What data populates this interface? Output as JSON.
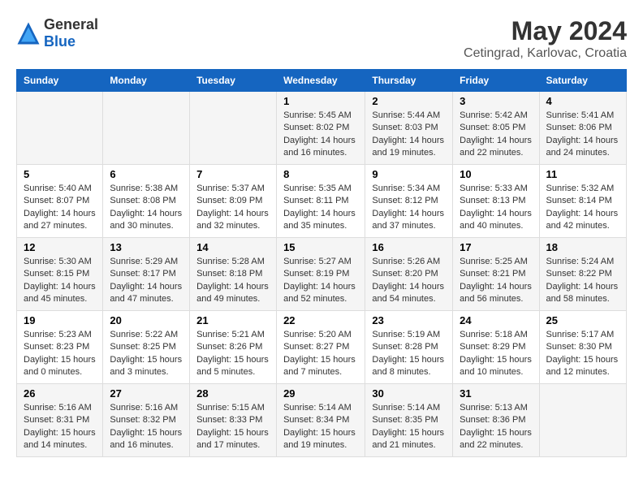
{
  "header": {
    "logo_general": "General",
    "logo_blue": "Blue",
    "title": "May 2024",
    "subtitle": "Cetingrad, Karlovac, Croatia"
  },
  "days_of_week": [
    "Sunday",
    "Monday",
    "Tuesday",
    "Wednesday",
    "Thursday",
    "Friday",
    "Saturday"
  ],
  "weeks": [
    [
      {
        "day": "",
        "info": ""
      },
      {
        "day": "",
        "info": ""
      },
      {
        "day": "",
        "info": ""
      },
      {
        "day": "1",
        "info": "Sunrise: 5:45 AM\nSunset: 8:02 PM\nDaylight: 14 hours\nand 16 minutes."
      },
      {
        "day": "2",
        "info": "Sunrise: 5:44 AM\nSunset: 8:03 PM\nDaylight: 14 hours\nand 19 minutes."
      },
      {
        "day": "3",
        "info": "Sunrise: 5:42 AM\nSunset: 8:05 PM\nDaylight: 14 hours\nand 22 minutes."
      },
      {
        "day": "4",
        "info": "Sunrise: 5:41 AM\nSunset: 8:06 PM\nDaylight: 14 hours\nand 24 minutes."
      }
    ],
    [
      {
        "day": "5",
        "info": "Sunrise: 5:40 AM\nSunset: 8:07 PM\nDaylight: 14 hours\nand 27 minutes."
      },
      {
        "day": "6",
        "info": "Sunrise: 5:38 AM\nSunset: 8:08 PM\nDaylight: 14 hours\nand 30 minutes."
      },
      {
        "day": "7",
        "info": "Sunrise: 5:37 AM\nSunset: 8:09 PM\nDaylight: 14 hours\nand 32 minutes."
      },
      {
        "day": "8",
        "info": "Sunrise: 5:35 AM\nSunset: 8:11 PM\nDaylight: 14 hours\nand 35 minutes."
      },
      {
        "day": "9",
        "info": "Sunrise: 5:34 AM\nSunset: 8:12 PM\nDaylight: 14 hours\nand 37 minutes."
      },
      {
        "day": "10",
        "info": "Sunrise: 5:33 AM\nSunset: 8:13 PM\nDaylight: 14 hours\nand 40 minutes."
      },
      {
        "day": "11",
        "info": "Sunrise: 5:32 AM\nSunset: 8:14 PM\nDaylight: 14 hours\nand 42 minutes."
      }
    ],
    [
      {
        "day": "12",
        "info": "Sunrise: 5:30 AM\nSunset: 8:15 PM\nDaylight: 14 hours\nand 45 minutes."
      },
      {
        "day": "13",
        "info": "Sunrise: 5:29 AM\nSunset: 8:17 PM\nDaylight: 14 hours\nand 47 minutes."
      },
      {
        "day": "14",
        "info": "Sunrise: 5:28 AM\nSunset: 8:18 PM\nDaylight: 14 hours\nand 49 minutes."
      },
      {
        "day": "15",
        "info": "Sunrise: 5:27 AM\nSunset: 8:19 PM\nDaylight: 14 hours\nand 52 minutes."
      },
      {
        "day": "16",
        "info": "Sunrise: 5:26 AM\nSunset: 8:20 PM\nDaylight: 14 hours\nand 54 minutes."
      },
      {
        "day": "17",
        "info": "Sunrise: 5:25 AM\nSunset: 8:21 PM\nDaylight: 14 hours\nand 56 minutes."
      },
      {
        "day": "18",
        "info": "Sunrise: 5:24 AM\nSunset: 8:22 PM\nDaylight: 14 hours\nand 58 minutes."
      }
    ],
    [
      {
        "day": "19",
        "info": "Sunrise: 5:23 AM\nSunset: 8:23 PM\nDaylight: 15 hours\nand 0 minutes."
      },
      {
        "day": "20",
        "info": "Sunrise: 5:22 AM\nSunset: 8:25 PM\nDaylight: 15 hours\nand 3 minutes."
      },
      {
        "day": "21",
        "info": "Sunrise: 5:21 AM\nSunset: 8:26 PM\nDaylight: 15 hours\nand 5 minutes."
      },
      {
        "day": "22",
        "info": "Sunrise: 5:20 AM\nSunset: 8:27 PM\nDaylight: 15 hours\nand 7 minutes."
      },
      {
        "day": "23",
        "info": "Sunrise: 5:19 AM\nSunset: 8:28 PM\nDaylight: 15 hours\nand 8 minutes."
      },
      {
        "day": "24",
        "info": "Sunrise: 5:18 AM\nSunset: 8:29 PM\nDaylight: 15 hours\nand 10 minutes."
      },
      {
        "day": "25",
        "info": "Sunrise: 5:17 AM\nSunset: 8:30 PM\nDaylight: 15 hours\nand 12 minutes."
      }
    ],
    [
      {
        "day": "26",
        "info": "Sunrise: 5:16 AM\nSunset: 8:31 PM\nDaylight: 15 hours\nand 14 minutes."
      },
      {
        "day": "27",
        "info": "Sunrise: 5:16 AM\nSunset: 8:32 PM\nDaylight: 15 hours\nand 16 minutes."
      },
      {
        "day": "28",
        "info": "Sunrise: 5:15 AM\nSunset: 8:33 PM\nDaylight: 15 hours\nand 17 minutes."
      },
      {
        "day": "29",
        "info": "Sunrise: 5:14 AM\nSunset: 8:34 PM\nDaylight: 15 hours\nand 19 minutes."
      },
      {
        "day": "30",
        "info": "Sunrise: 5:14 AM\nSunset: 8:35 PM\nDaylight: 15 hours\nand 21 minutes."
      },
      {
        "day": "31",
        "info": "Sunrise: 5:13 AM\nSunset: 8:36 PM\nDaylight: 15 hours\nand 22 minutes."
      },
      {
        "day": "",
        "info": ""
      }
    ]
  ]
}
